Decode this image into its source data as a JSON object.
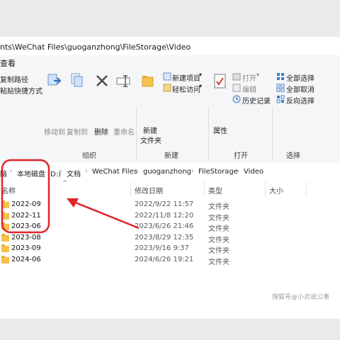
{
  "window": {
    "title": "nts\\WeChat Files\\guoganzhong\\FileStorage\\Video"
  },
  "menu": {
    "view": "查看"
  },
  "ribbon": {
    "copy_path": "复制路径",
    "paste_shortcut": "粘贴快捷方式",
    "move_to": "移动到",
    "copy_to": "复制到",
    "delete": "删除",
    "rename": "重命名",
    "new_folder_line1": "新建",
    "new_folder_line2": "文件夹",
    "new_item": "新建项目",
    "easy_access": "轻松访问",
    "properties": "属性",
    "open": "打开",
    "edit": "编辑",
    "history": "历史记录",
    "select_all": "全部选择",
    "select_none": "全部取消",
    "invert_selection": "反向选择",
    "group_organize": "组织",
    "group_new": "新建",
    "group_open": "打开",
    "group_select": "选择"
  },
  "address": {
    "crumbs": [
      "脑",
      "本地磁盘 (D:)",
      "文档",
      "WeChat Files",
      "guoganzhong",
      "FileStorage",
      "Video"
    ]
  },
  "columns": {
    "name": "名称",
    "date": "修改日期",
    "type": "类型",
    "size": "大小"
  },
  "files": [
    {
      "name": "2022-09",
      "date": "2022/9/22 11:57",
      "type": "文件夹"
    },
    {
      "name": "2022-11",
      "date": "2022/11/8 12:20",
      "type": "文件夹"
    },
    {
      "name": "2023-06",
      "date": "2023/6/26 21:46",
      "type": "文件夹"
    },
    {
      "name": "2023-08",
      "date": "2023/8/29 12:35",
      "type": "文件夹"
    },
    {
      "name": "2023-09",
      "date": "2023/9/16 9:37",
      "type": "文件夹"
    },
    {
      "name": "2024-06",
      "date": "2024/6/26 19:21",
      "type": "文件夹"
    }
  ],
  "watermark": "搜狐号@小贞说公事",
  "colors": {
    "annotation": "#e0242a",
    "folder": "#f6c14a",
    "window_bg": "#ffffff",
    "ribbon_bg": "#f5f6f8"
  }
}
